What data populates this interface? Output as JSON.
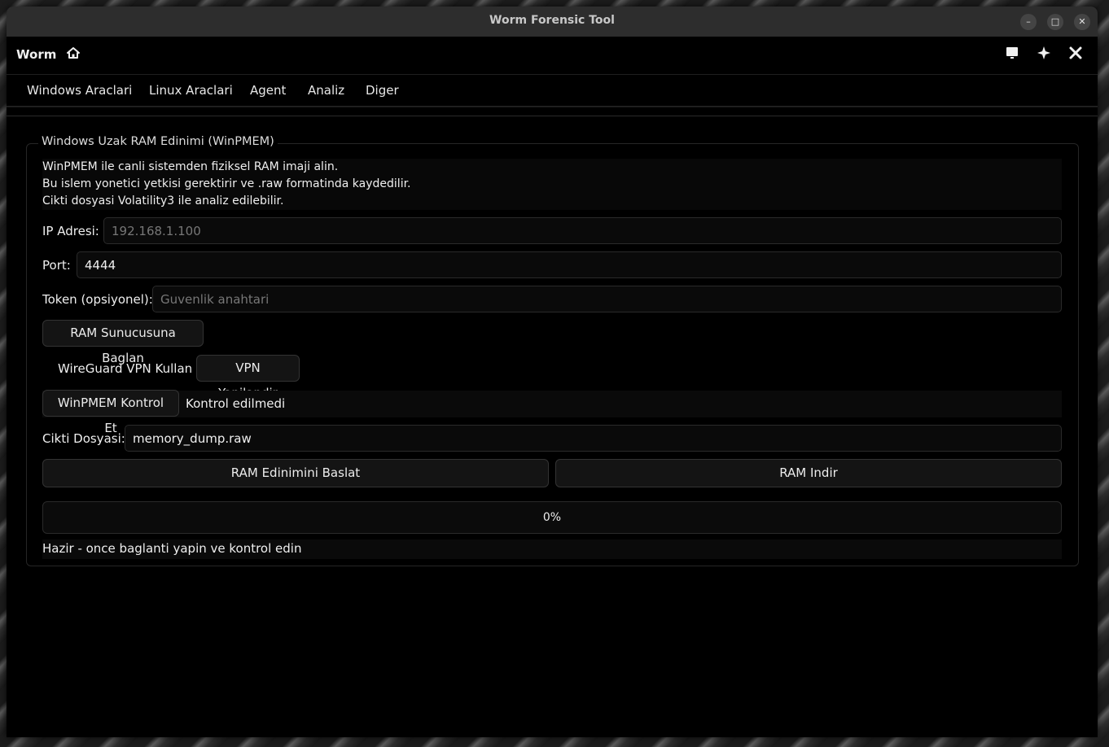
{
  "window": {
    "title": "Worm Forensic Tool"
  },
  "header": {
    "app_name": "Worm",
    "icons": [
      "home-icon",
      "screen-icon",
      "sparkle-icon",
      "tools-icon"
    ]
  },
  "menu": {
    "items": [
      {
        "label": "Windows Araclari"
      },
      {
        "label": "Linux Araclari"
      },
      {
        "label": "Agent"
      },
      {
        "label": "Analiz"
      },
      {
        "label": "Diger"
      }
    ]
  },
  "panel": {
    "title": "Windows Uzak RAM Edinimi (WinPMEM)",
    "description": [
      "WinPMEM ile canli sistemden fiziksel RAM imaji alin.",
      "Bu islem yonetici yetkisi gerektirir ve .raw formatinda kaydedilir.",
      "Cikti dosyasi Volatility3 ile analiz edilebilir."
    ],
    "ip": {
      "label": "IP Adresi:",
      "value": "",
      "placeholder": "192.168.1.100"
    },
    "port": {
      "label": "Port:",
      "value": "4444",
      "placeholder": ""
    },
    "token": {
      "label": "Token (opsiyonel):",
      "value": "",
      "placeholder": "Guvenlik anahtari"
    },
    "connect_button": "RAM Sunucusuna Baglan",
    "vpn_label": "WireGuard VPN Kullan",
    "vpn_button": "VPN Yapilandir",
    "check_button": "WinPMEM Kontrol Et",
    "check_status": "Kontrol edilmedi",
    "output": {
      "label": "Cikti Dosyasi:",
      "value": "memory_dump.raw"
    },
    "start_button": "RAM Edinimini Baslat",
    "download_button": "RAM Indir",
    "progress": {
      "value": 0,
      "text": "0%"
    },
    "status": "Hazir - once baglanti yapin ve kontrol edin"
  }
}
